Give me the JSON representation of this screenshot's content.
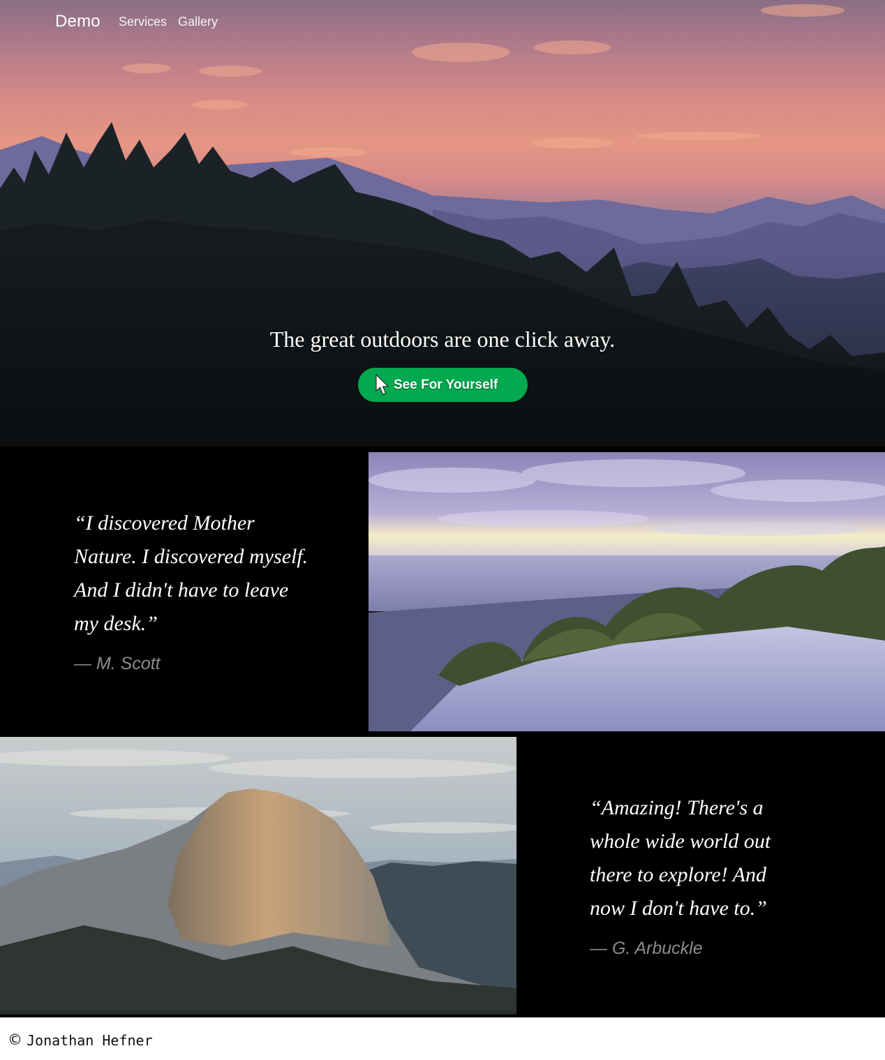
{
  "navbar": {
    "brand": "Demo",
    "links": [
      {
        "label": "Services"
      },
      {
        "label": "Gallery"
      }
    ]
  },
  "hero": {
    "title": "The great outdoors are one click away.",
    "cta_label": "See For Yourself",
    "cta_icon": "mouse-pointer-icon",
    "cta_color": "#03a84f"
  },
  "testimonials": [
    {
      "quote": "“I discovered Mother Nature. I discovered myself. And I didn't have to leave my desk.”",
      "author": "— M. Scott",
      "photo": "beach-dunes-photo"
    },
    {
      "quote": "“Amazing! There's a whole wide world out there to explore! And now I don't have to.”",
      "author": "— G. Arbuckle",
      "photo": "half-dome-photo"
    }
  ],
  "footer": {
    "copyright_symbol": "©",
    "owner": "Jonathan Hefner"
  }
}
